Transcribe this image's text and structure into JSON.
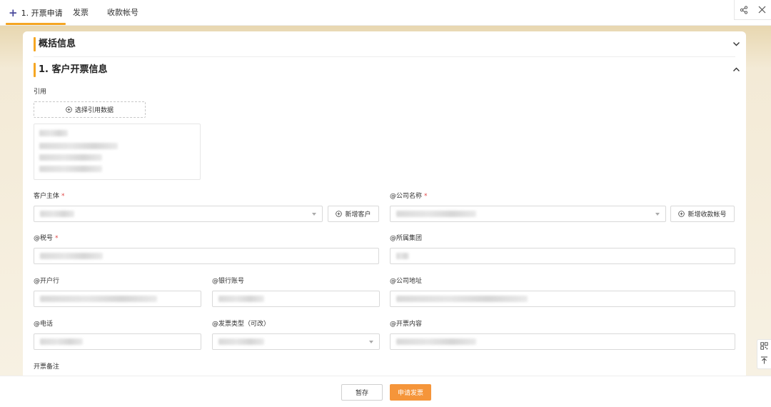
{
  "tabs": [
    {
      "label": "1. 开票申请",
      "active": true
    },
    {
      "label": "发票"
    },
    {
      "label": "收款帐号"
    }
  ],
  "top_icons": [
    "share-icon",
    "close-icon"
  ],
  "summary_section": {
    "title": "概括信息"
  },
  "customer_section": {
    "title": "1. 客户开票信息"
  },
  "reference": {
    "label": "引用",
    "select_button": "选择引用数据"
  },
  "fields": {
    "customer_subject": {
      "label": "客户主体",
      "required": "*"
    },
    "company_name": {
      "label": "@公司名称",
      "required": "*"
    },
    "tax_number": {
      "label": "@税号",
      "required": "*"
    },
    "group": {
      "label": "@所属集团"
    },
    "bank": {
      "label": "@开户行"
    },
    "bank_account": {
      "label": "@银行账号"
    },
    "company_address": {
      "label": "@公司地址"
    },
    "phone": {
      "label": "@电话"
    },
    "invoice_type": {
      "label": "@发票类型（可改）"
    },
    "invoice_content": {
      "label": "@开票内容"
    },
    "invoice_remark": {
      "label": "开票备注"
    }
  },
  "buttons": {
    "add_customer": "新增客户",
    "add_account": "新增收款帐号",
    "save": "暂存",
    "apply": "申请发票"
  },
  "colors": {
    "accent": "#f5a623",
    "primary_button": "#f5953a",
    "required": "#e04545"
  }
}
